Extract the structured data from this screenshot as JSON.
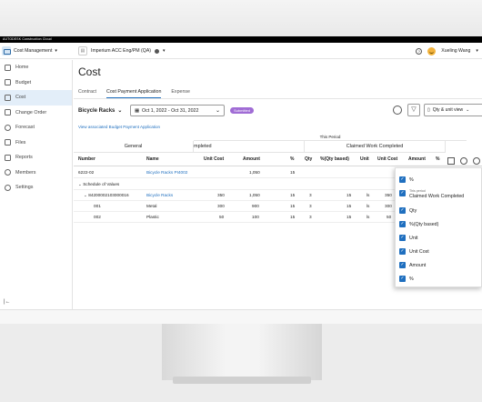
{
  "brand": "AUTODESK Construction Cloud",
  "app_switcher": {
    "label": "Cost Management"
  },
  "project": {
    "name": "Imperium ACC Eng/PM (QA)"
  },
  "user": {
    "name": "Xueling Wang"
  },
  "sidebar": {
    "items": [
      {
        "label": "Home",
        "icon": "home-icon"
      },
      {
        "label": "Budget",
        "icon": "budget-icon"
      },
      {
        "label": "Cost",
        "icon": "cost-icon",
        "active": true
      },
      {
        "label": "Change Order",
        "icon": "change-order-icon"
      },
      {
        "label": "Forecast",
        "icon": "forecast-icon"
      },
      {
        "label": "Files",
        "icon": "files-icon"
      },
      {
        "label": "Reports",
        "icon": "reports-icon"
      },
      {
        "label": "Members",
        "icon": "members-icon"
      },
      {
        "label": "Settings",
        "icon": "settings-icon"
      }
    ],
    "collapse_icon": "collapse-sidebar-icon"
  },
  "page": {
    "title": "Cost",
    "tabs": [
      {
        "label": "Contract"
      },
      {
        "label": "Cost Payment Application",
        "active": true
      },
      {
        "label": "Expense"
      }
    ]
  },
  "toolbar": {
    "contract": "Bicycle Racks",
    "date_range": "Oct 1, 2022 - Oct 31, 2022",
    "status": "Submitted",
    "view_label": "Qty & unit view"
  },
  "link_budget_app": "View associated Budget Payment Application",
  "grid": {
    "group_this_period": "This Period",
    "group_general": "General",
    "group_completed": "mpleted",
    "group_claimed": "Claimed Work Completed",
    "columns": [
      "Number",
      "Name",
      "Unit Cost",
      "Amount",
      "%",
      "Qty",
      "%(Qty based)",
      "Unit",
      "Unit Cost",
      "Amount",
      "%"
    ],
    "rows": [
      {
        "number": "6222-02",
        "name": "Bicycle Racks PI4002",
        "unit_cost": "",
        "amount": "1,050",
        "pct": "15",
        "qty": "",
        "pct_qty": "",
        "unit": "",
        "unit_cost2": "",
        "name_link": true
      },
      {
        "number": "⌄ Schedule of Values",
        "name": "",
        "unit_cost": "",
        "amount": "",
        "pct": "",
        "qty": "",
        "pct_qty": "",
        "unit": "",
        "unit_cost2": ""
      },
      {
        "number": "⌄ 84200002103000016",
        "name": "Bicycle Racks",
        "unit_cost": "350",
        "amount": "1,050",
        "pct": "15",
        "qty": "3",
        "pct_qty": "15",
        "unit": "ls",
        "unit_cost2": "350",
        "name_link": true
      },
      {
        "number": "001",
        "name": "Metal",
        "unit_cost": "300",
        "amount": "900",
        "pct": "15",
        "qty": "3",
        "pct_qty": "15",
        "unit": "ls",
        "unit_cost2": "300"
      },
      {
        "number": "002",
        "name": "Plastic",
        "unit_cost": "50",
        "amount": "100",
        "pct": "15",
        "qty": "3",
        "pct_qty": "15",
        "unit": "ls",
        "unit_cost2": "50"
      }
    ]
  },
  "column_panel": {
    "options": [
      {
        "label": "%",
        "checked": true
      },
      {
        "label": "Claimed Work Completed",
        "caption": "This period",
        "checked": true
      },
      {
        "label": "Qty",
        "checked": true
      },
      {
        "label": "%(Qty based)",
        "checked": true
      },
      {
        "label": "Unit",
        "checked": true
      },
      {
        "label": "Unit Cost",
        "checked": true
      },
      {
        "label": "Amount",
        "checked": true
      },
      {
        "label": "%",
        "checked": true
      }
    ]
  },
  "colors": {
    "accent": "#1f6fbf",
    "status_badge": "#a06cd5",
    "sidebar_active": "#e3eef9"
  }
}
